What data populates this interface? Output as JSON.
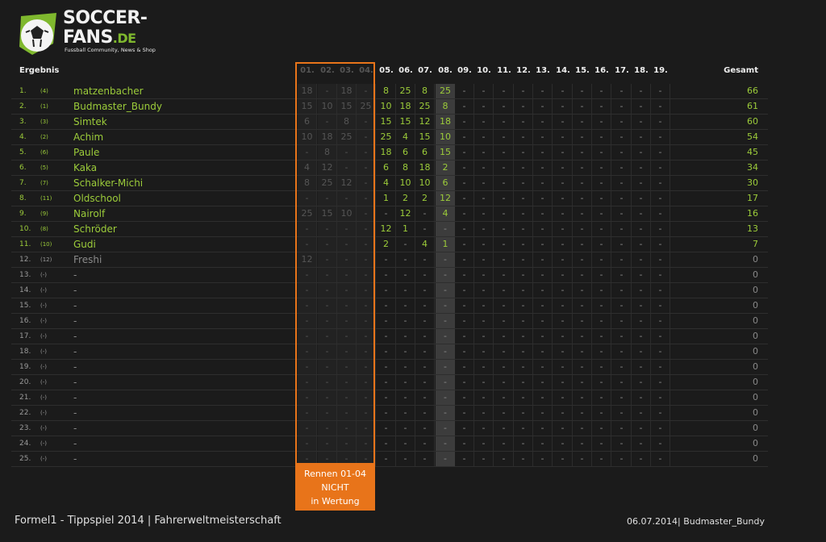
{
  "logo": {
    "line1": "SOCCER-",
    "line2": "FANS",
    "tld": ".DE",
    "tagline": "Fussball Community, News & Shop"
  },
  "header": {
    "result_label": "Ergebnis",
    "races": [
      "01.",
      "02.",
      "03.",
      "04.",
      "05.",
      "06.",
      "07.",
      "08.",
      "09.",
      "10.",
      "11.",
      "12.",
      "13.",
      "14.",
      "15.",
      "16.",
      "17.",
      "18.",
      "19."
    ],
    "total_label": "Gesamt"
  },
  "rows": [
    {
      "pos": "1.",
      "prev": "(4)",
      "name": "matzenbacher",
      "scores": [
        "18",
        "-",
        "18",
        "-",
        "8",
        "25",
        "8",
        "25",
        "-",
        "-",
        "-",
        "-",
        "-",
        "-",
        "-",
        "-",
        "-",
        "-",
        "-"
      ],
      "total": "66"
    },
    {
      "pos": "2.",
      "prev": "(1)",
      "name": "Budmaster_Bundy",
      "scores": [
        "15",
        "10",
        "15",
        "25",
        "10",
        "18",
        "25",
        "8",
        "-",
        "-",
        "-",
        "-",
        "-",
        "-",
        "-",
        "-",
        "-",
        "-",
        "-"
      ],
      "total": "61"
    },
    {
      "pos": "3.",
      "prev": "(3)",
      "name": "Simtek",
      "scores": [
        "6",
        "-",
        "8",
        "-",
        "15",
        "15",
        "12",
        "18",
        "-",
        "-",
        "-",
        "-",
        "-",
        "-",
        "-",
        "-",
        "-",
        "-",
        "-"
      ],
      "total": "60"
    },
    {
      "pos": "4.",
      "prev": "(2)",
      "name": "Achim",
      "scores": [
        "10",
        "18",
        "25",
        "-",
        "25",
        "4",
        "15",
        "10",
        "-",
        "-",
        "-",
        "-",
        "-",
        "-",
        "-",
        "-",
        "-",
        "-",
        "-"
      ],
      "total": "54"
    },
    {
      "pos": "5.",
      "prev": "(6)",
      "name": "Paule",
      "scores": [
        "-",
        "8",
        "-",
        "-",
        "18",
        "6",
        "6",
        "15",
        "-",
        "-",
        "-",
        "-",
        "-",
        "-",
        "-",
        "-",
        "-",
        "-",
        "-"
      ],
      "total": "45"
    },
    {
      "pos": "6.",
      "prev": "(5)",
      "name": "Kaka",
      "scores": [
        "4",
        "12",
        "-",
        "-",
        "6",
        "8",
        "18",
        "2",
        "-",
        "-",
        "-",
        "-",
        "-",
        "-",
        "-",
        "-",
        "-",
        "-",
        "-"
      ],
      "total": "34"
    },
    {
      "pos": "7.",
      "prev": "(7)",
      "name": "Schalker-Michi",
      "scores": [
        "8",
        "25",
        "12",
        "-",
        "4",
        "10",
        "10",
        "6",
        "-",
        "-",
        "-",
        "-",
        "-",
        "-",
        "-",
        "-",
        "-",
        "-",
        "-"
      ],
      "total": "30"
    },
    {
      "pos": "8.",
      "prev": "(11)",
      "name": "Oldschool",
      "scores": [
        "-",
        "-",
        "-",
        "-",
        "1",
        "2",
        "2",
        "12",
        "-",
        "-",
        "-",
        "-",
        "-",
        "-",
        "-",
        "-",
        "-",
        "-",
        "-"
      ],
      "total": "17"
    },
    {
      "pos": "9.",
      "prev": "(9)",
      "name": "Nairolf",
      "scores": [
        "25",
        "15",
        "10",
        "-",
        "-",
        "12",
        "-",
        "4",
        "-",
        "-",
        "-",
        "-",
        "-",
        "-",
        "-",
        "-",
        "-",
        "-",
        "-"
      ],
      "total": "16"
    },
    {
      "pos": "10.",
      "prev": "(8)",
      "name": "Schröder",
      "scores": [
        "-",
        "-",
        "-",
        "-",
        "12",
        "1",
        "-",
        "-",
        "-",
        "-",
        "-",
        "-",
        "-",
        "-",
        "-",
        "-",
        "-",
        "-",
        "-"
      ],
      "total": "13"
    },
    {
      "pos": "11.",
      "prev": "(10)",
      "name": "Gudi",
      "scores": [
        "-",
        "-",
        "-",
        "-",
        "2",
        "-",
        "4",
        "1",
        "-",
        "-",
        "-",
        "-",
        "-",
        "-",
        "-",
        "-",
        "-",
        "-",
        "-"
      ],
      "total": "7"
    },
    {
      "pos": "12.",
      "prev": "(12)",
      "name": "Freshi",
      "scores": [
        "12",
        "-",
        "-",
        "-",
        "-",
        "-",
        "-",
        "-",
        "-",
        "-",
        "-",
        "-",
        "-",
        "-",
        "-",
        "-",
        "-",
        "-",
        "-"
      ],
      "total": "0"
    },
    {
      "pos": "13.",
      "prev": "(-)",
      "name": "-",
      "scores": [
        "-",
        "-",
        "-",
        "-",
        "-",
        "-",
        "-",
        "-",
        "-",
        "-",
        "-",
        "-",
        "-",
        "-",
        "-",
        "-",
        "-",
        "-",
        "-"
      ],
      "total": "0"
    },
    {
      "pos": "14.",
      "prev": "(-)",
      "name": "-",
      "scores": [
        "-",
        "-",
        "-",
        "-",
        "-",
        "-",
        "-",
        "-",
        "-",
        "-",
        "-",
        "-",
        "-",
        "-",
        "-",
        "-",
        "-",
        "-",
        "-"
      ],
      "total": "0"
    },
    {
      "pos": "15.",
      "prev": "(-)",
      "name": "-",
      "scores": [
        "-",
        "-",
        "-",
        "-",
        "-",
        "-",
        "-",
        "-",
        "-",
        "-",
        "-",
        "-",
        "-",
        "-",
        "-",
        "-",
        "-",
        "-",
        "-"
      ],
      "total": "0"
    },
    {
      "pos": "16.",
      "prev": "(-)",
      "name": "-",
      "scores": [
        "-",
        "-",
        "-",
        "-",
        "-",
        "-",
        "-",
        "-",
        "-",
        "-",
        "-",
        "-",
        "-",
        "-",
        "-",
        "-",
        "-",
        "-",
        "-"
      ],
      "total": "0"
    },
    {
      "pos": "17.",
      "prev": "(-)",
      "name": "-",
      "scores": [
        "-",
        "-",
        "-",
        "-",
        "-",
        "-",
        "-",
        "-",
        "-",
        "-",
        "-",
        "-",
        "-",
        "-",
        "-",
        "-",
        "-",
        "-",
        "-"
      ],
      "total": "0"
    },
    {
      "pos": "18.",
      "prev": "(-)",
      "name": "-",
      "scores": [
        "-",
        "-",
        "-",
        "-",
        "-",
        "-",
        "-",
        "-",
        "-",
        "-",
        "-",
        "-",
        "-",
        "-",
        "-",
        "-",
        "-",
        "-",
        "-"
      ],
      "total": "0"
    },
    {
      "pos": "19.",
      "prev": "(-)",
      "name": "-",
      "scores": [
        "-",
        "-",
        "-",
        "-",
        "-",
        "-",
        "-",
        "-",
        "-",
        "-",
        "-",
        "-",
        "-",
        "-",
        "-",
        "-",
        "-",
        "-",
        "-"
      ],
      "total": "0"
    },
    {
      "pos": "20.",
      "prev": "(-)",
      "name": "-",
      "scores": [
        "-",
        "-",
        "-",
        "-",
        "-",
        "-",
        "-",
        "-",
        "-",
        "-",
        "-",
        "-",
        "-",
        "-",
        "-",
        "-",
        "-",
        "-",
        "-"
      ],
      "total": "0"
    },
    {
      "pos": "21.",
      "prev": "(-)",
      "name": "-",
      "scores": [
        "-",
        "-",
        "-",
        "-",
        "-",
        "-",
        "-",
        "-",
        "-",
        "-",
        "-",
        "-",
        "-",
        "-",
        "-",
        "-",
        "-",
        "-",
        "-"
      ],
      "total": "0"
    },
    {
      "pos": "22.",
      "prev": "(-)",
      "name": "-",
      "scores": [
        "-",
        "-",
        "-",
        "-",
        "-",
        "-",
        "-",
        "-",
        "-",
        "-",
        "-",
        "-",
        "-",
        "-",
        "-",
        "-",
        "-",
        "-",
        "-"
      ],
      "total": "0"
    },
    {
      "pos": "23.",
      "prev": "(-)",
      "name": "-",
      "scores": [
        "-",
        "-",
        "-",
        "-",
        "-",
        "-",
        "-",
        "-",
        "-",
        "-",
        "-",
        "-",
        "-",
        "-",
        "-",
        "-",
        "-",
        "-",
        "-"
      ],
      "total": "0"
    },
    {
      "pos": "24.",
      "prev": "(-)",
      "name": "-",
      "scores": [
        "-",
        "-",
        "-",
        "-",
        "-",
        "-",
        "-",
        "-",
        "-",
        "-",
        "-",
        "-",
        "-",
        "-",
        "-",
        "-",
        "-",
        "-",
        "-"
      ],
      "total": "0"
    },
    {
      "pos": "25.",
      "prev": "(-)",
      "name": "-",
      "scores": [
        "-",
        "-",
        "-",
        "-",
        "-",
        "-",
        "-",
        "-",
        "-",
        "-",
        "-",
        "-",
        "-",
        "-",
        "-",
        "-",
        "-",
        "-",
        "-"
      ],
      "total": "0"
    }
  ],
  "notice": {
    "line1": "Rennen 01-04",
    "line2": "NICHT",
    "line3": "in Wertung"
  },
  "footer": {
    "left": "Formel1 - Tippspiel 2014  |  Fahrerweltmeisterschaft",
    "date": "06.07.2014",
    "user": "Budmaster_Bundy"
  },
  "colors": {
    "accent_green": "#9ccc3a",
    "highlight_orange": "#e8741a",
    "background": "#1b1b1b"
  }
}
